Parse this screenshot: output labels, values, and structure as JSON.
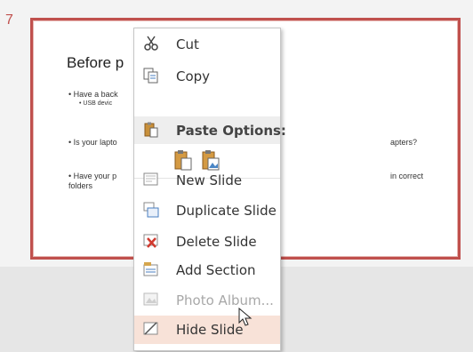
{
  "slide": {
    "number": "7",
    "title": "Before p",
    "bullets": {
      "b1": "• Have a back",
      "b1_sub": "• USB devic",
      "b2": "• Is your lapto",
      "b2_right": "apters?",
      "b3": "• Have your p\nfolders",
      "b3_right": "in correct"
    }
  },
  "context_menu": {
    "items": [
      {
        "label": "Cut",
        "icon": "scissors-icon"
      },
      {
        "label": "Copy",
        "icon": "copy-icon"
      },
      {
        "label": "Paste Options:",
        "icon": "paste-icon"
      },
      {
        "label": "New Slide",
        "icon": "new-slide-icon"
      },
      {
        "label": "Duplicate Slide",
        "icon": "duplicate-slide-icon"
      },
      {
        "label": "Delete Slide",
        "icon": "delete-slide-icon"
      },
      {
        "label": "Add Section",
        "icon": "add-section-icon"
      },
      {
        "label": "Photo Album...",
        "icon": "photo-album-icon",
        "disabled": true
      },
      {
        "label": "Hide Slide",
        "icon": "hide-slide-icon",
        "hover": true
      }
    ],
    "paste_options": [
      "keep-source-formatting-icon",
      "picture-icon"
    ]
  },
  "colors": {
    "accent": "#c0504d",
    "hover_bg": "#f8e2d8"
  }
}
